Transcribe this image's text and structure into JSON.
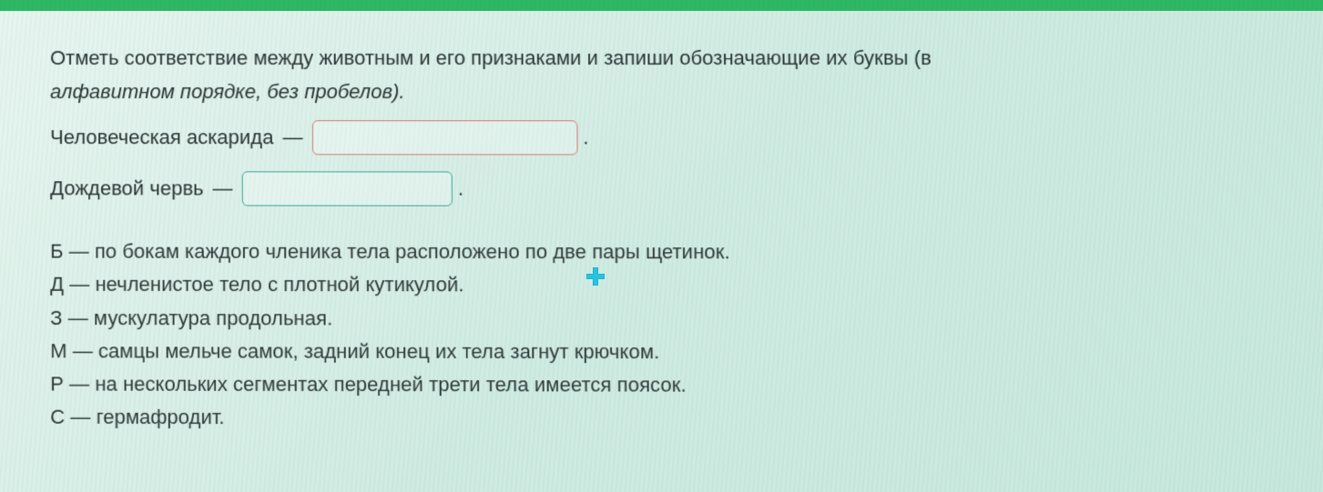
{
  "prompt": {
    "line1": "Отметь соответствие между животным и его признаками и запиши обозначающие их буквы (в",
    "line2_italic": "алфавитном порядке, без пробелов)."
  },
  "answers": {
    "item1": {
      "label": "Человеческая аскарида",
      "dash": "—",
      "value": "",
      "trailing": "."
    },
    "item2": {
      "label": "Дождевой червь",
      "dash": "—",
      "value": "",
      "trailing": "."
    }
  },
  "options": {
    "B": {
      "letter": "Б",
      "dash": "—",
      "text": "по бокам каждого членика тела расположено по две пары щетинок."
    },
    "D": {
      "letter": "Д",
      "dash": "—",
      "text": "нечленистое тело с плотной кутикулой."
    },
    "Z": {
      "letter": "З",
      "dash": "—",
      "text": "мускулатура продольная."
    },
    "M": {
      "letter": "М",
      "dash": "—",
      "text": "самцы мельче самок, задний конец их тела загнут крючком."
    },
    "R": {
      "letter": "Р",
      "dash": "—",
      "text": "на нескольких сегментах передней трети тела имеется поясок."
    },
    "S": {
      "letter": "С",
      "dash": "—",
      "text": "гермафродит."
    }
  },
  "cursor": {
    "name": "cursor-plus"
  }
}
